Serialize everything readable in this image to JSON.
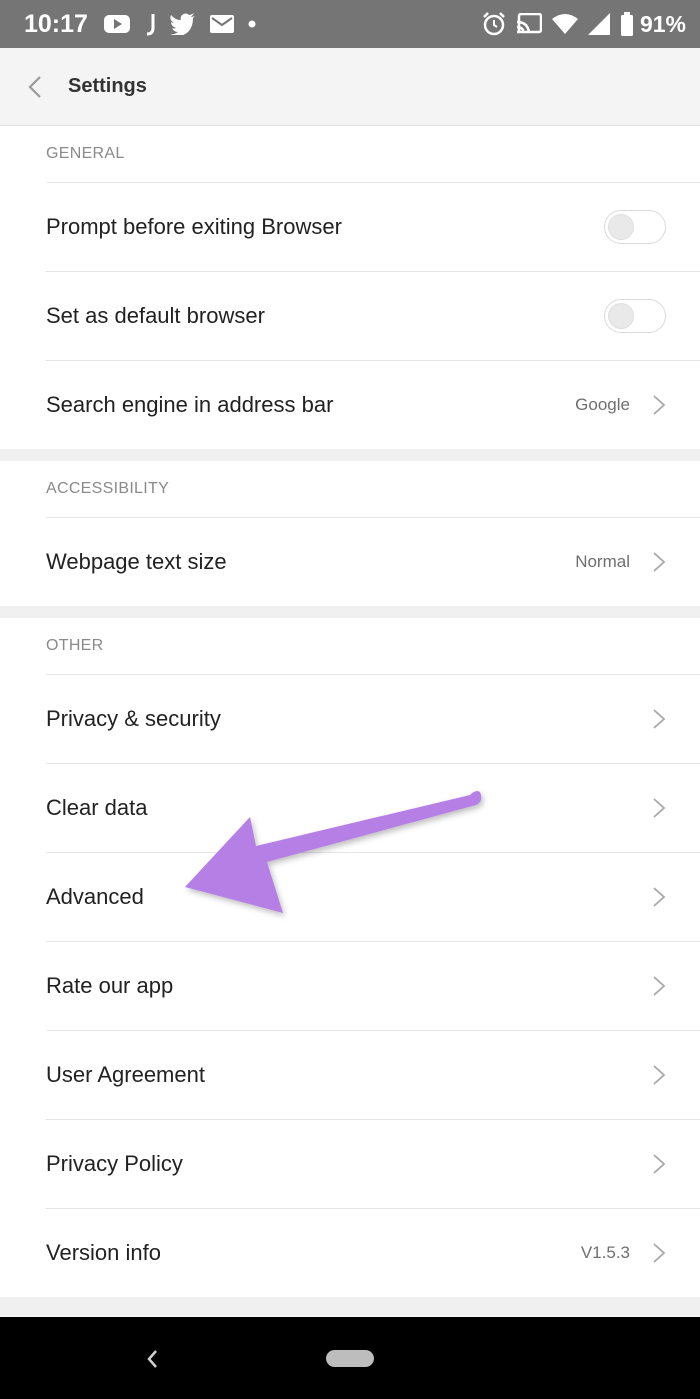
{
  "status_bar": {
    "time": "10:17",
    "battery": "91%",
    "left_icons": [
      "youtube-icon",
      "j-icon",
      "twitter-icon",
      "mail-icon",
      "dot-icon"
    ],
    "right_icons": [
      "alarm-icon",
      "cast-icon",
      "wifi-icon",
      "signal-icon",
      "battery-icon"
    ]
  },
  "header": {
    "title": "Settings",
    "back_icon": "chevron-left-icon"
  },
  "sections": [
    {
      "title": "GENERAL",
      "rows": [
        {
          "label": "Prompt before exiting Browser",
          "control": "toggle",
          "on": false
        },
        {
          "label": "Set as default browser",
          "control": "toggle",
          "on": false
        },
        {
          "label": "Search engine in address bar",
          "control": "chevron",
          "value": "Google"
        }
      ]
    },
    {
      "title": "ACCESSIBILITY",
      "rows": [
        {
          "label": "Webpage text size",
          "control": "chevron",
          "value": "Normal"
        }
      ]
    },
    {
      "title": "OTHER",
      "rows": [
        {
          "label": "Privacy & security",
          "control": "chevron"
        },
        {
          "label": "Clear data",
          "control": "chevron"
        },
        {
          "label": "Advanced",
          "control": "chevron"
        },
        {
          "label": "Rate our app",
          "control": "chevron"
        },
        {
          "label": "User Agreement",
          "control": "chevron"
        },
        {
          "label": "Privacy Policy",
          "control": "chevron"
        },
        {
          "label": "Version info",
          "control": "chevron",
          "value": "V1.5.3"
        }
      ]
    }
  ],
  "annotation": {
    "color": "#b57fe6",
    "points_to": "Advanced"
  },
  "colors": {
    "status_bar": "#757575",
    "header_bg": "#f4f4f4",
    "text": "#222222",
    "secondary_text": "#8a8a8a"
  }
}
